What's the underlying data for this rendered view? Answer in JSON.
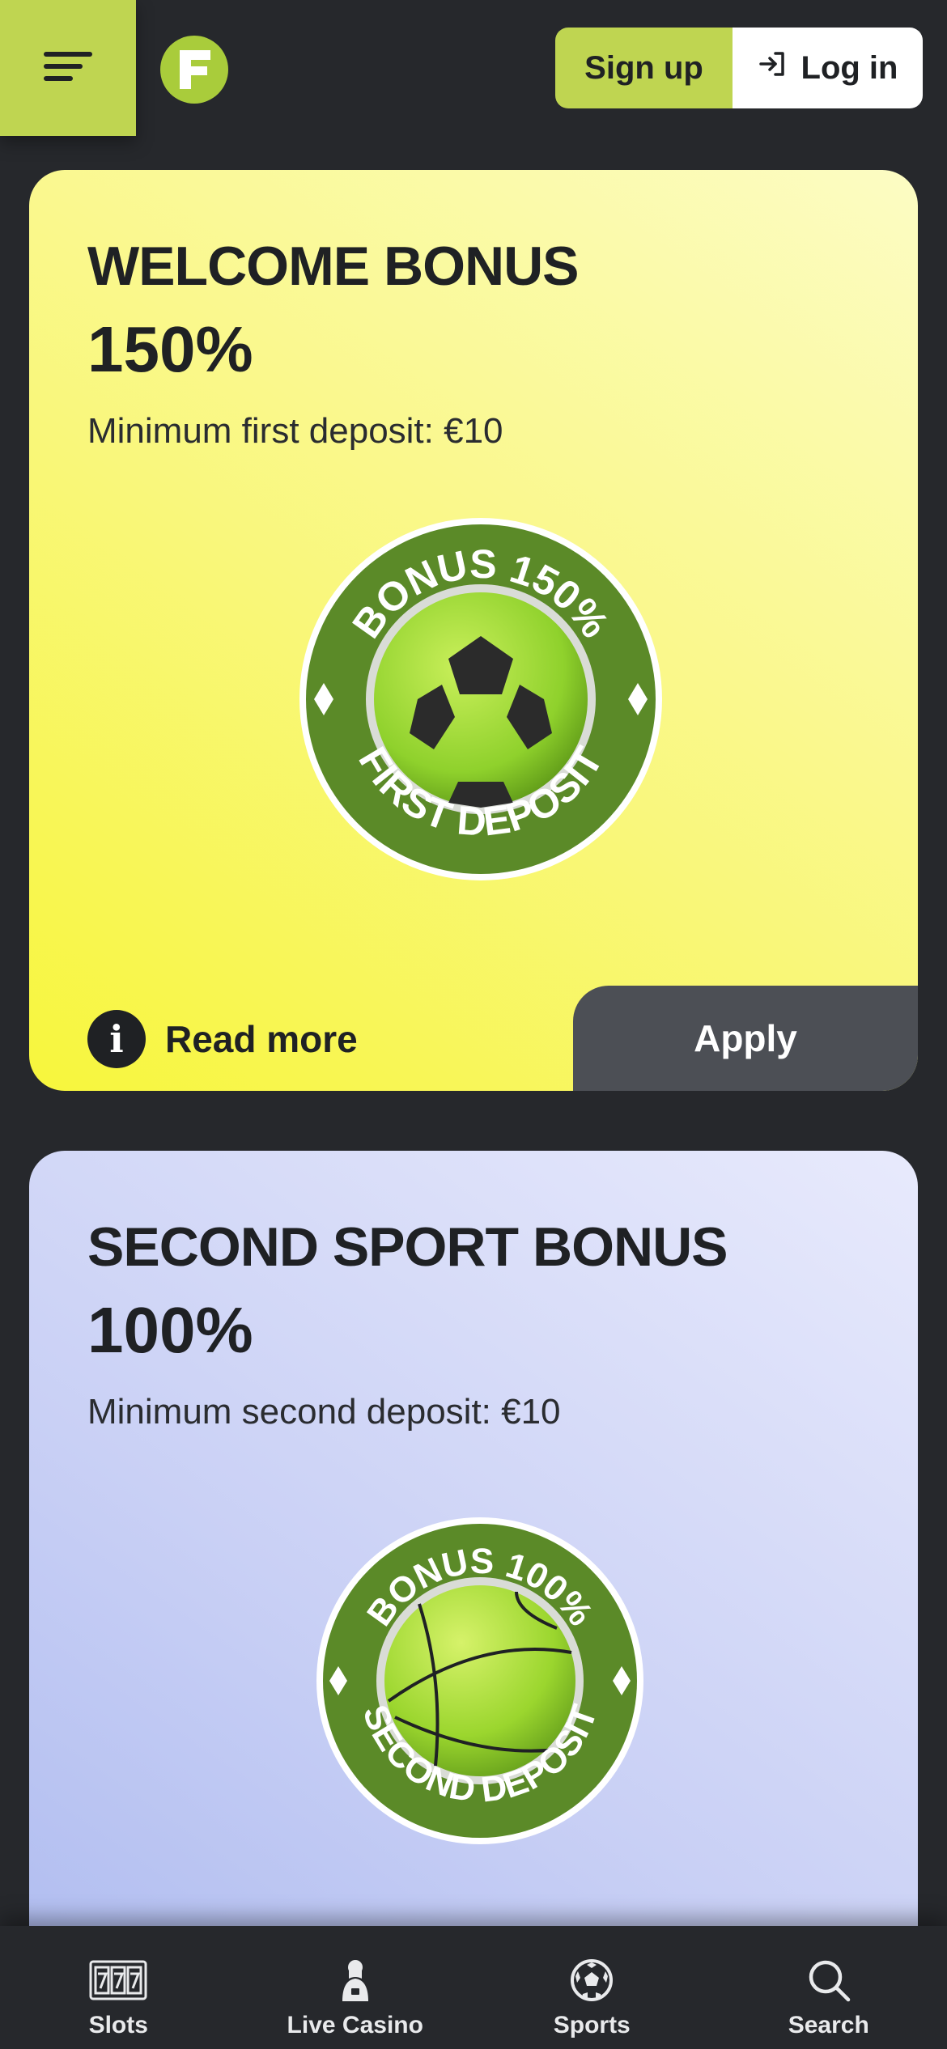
{
  "header": {
    "menu_icon": "hamburger-menu-icon",
    "logo_letter": "F",
    "signup_label": "Sign up",
    "login_label": "Log in",
    "login_icon": "login-arrow-icon"
  },
  "bonuses": [
    {
      "title": "WELCOME BONUS",
      "percent": "150%",
      "subtitle": "Minimum first deposit: €10",
      "badge": {
        "top_text": "BONUS 150%",
        "bottom_text": "FIRST DEPOSIT",
        "ball": "soccer-ball"
      },
      "read_more_label": "Read more",
      "apply_label": "Apply"
    },
    {
      "title": "SECOND SPORT BONUS",
      "percent": "100%",
      "subtitle": "Minimum second deposit: €10",
      "badge": {
        "top_text": "BONUS 100%",
        "bottom_text": "SECOND DEPOSIT",
        "ball": "basketball"
      }
    }
  ],
  "bottom_nav": [
    {
      "label": "Slots",
      "icon": "slots-777-icon"
    },
    {
      "label": "Live Casino",
      "icon": "live-dealer-icon"
    },
    {
      "label": "Sports",
      "icon": "soccer-ball-icon"
    },
    {
      "label": "Search",
      "icon": "search-icon"
    }
  ],
  "colors": {
    "background": "#26282c",
    "accent_green": "#bfd551",
    "badge_green": "#5b8a28",
    "welcome_card_yellow": "#f7f63c",
    "second_card_blue": "#aab8ef",
    "apply_button": "#4c4f55"
  }
}
